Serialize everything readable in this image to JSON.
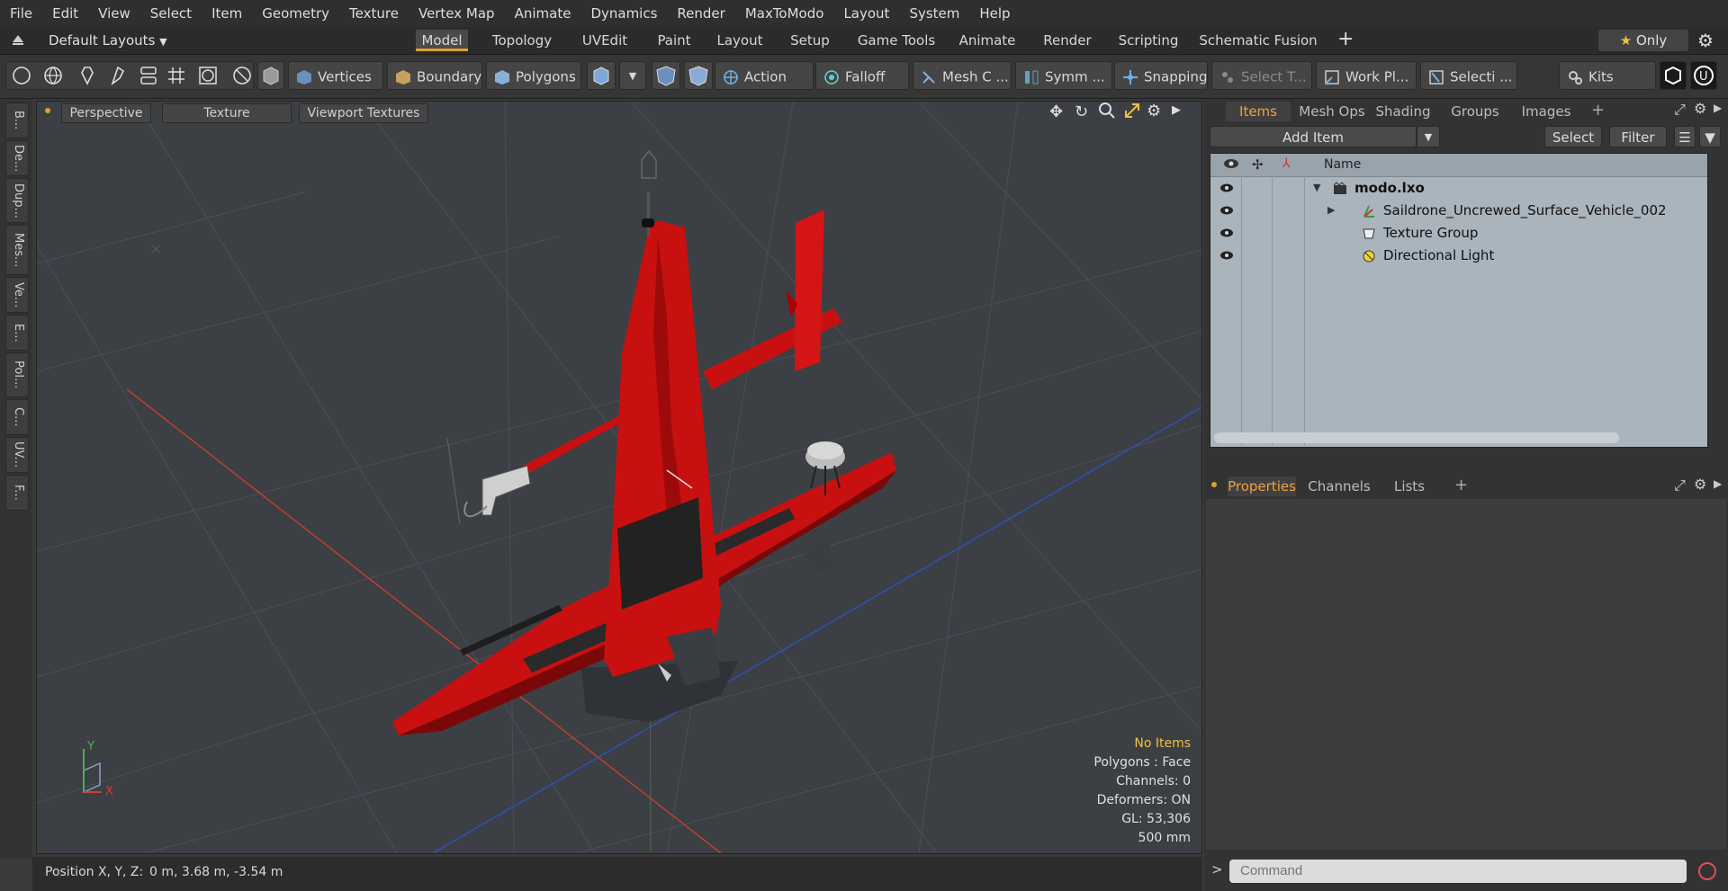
{
  "menu": [
    "File",
    "Edit",
    "View",
    "Select",
    "Item",
    "Geometry",
    "Texture",
    "Vertex Map",
    "Animate",
    "Dynamics",
    "Render",
    "MaxToModo",
    "Layout",
    "System",
    "Help"
  ],
  "layout_selector": "Default Layouts",
  "layout_tabs": [
    {
      "label": "Model",
      "active": true
    },
    {
      "label": "Topology"
    },
    {
      "label": "UVEdit"
    },
    {
      "label": "Paint"
    },
    {
      "label": "Layout"
    },
    {
      "label": "Setup"
    },
    {
      "label": "Game Tools"
    },
    {
      "label": "Animate"
    },
    {
      "label": "Render"
    },
    {
      "label": "Scripting"
    },
    {
      "label": "Schematic Fusion"
    }
  ],
  "only_label": "Only",
  "toolbar": {
    "vertices": "Vertices",
    "boundary": "Boundary",
    "polygons": "Polygons",
    "action": "Action",
    "falloff": "Falloff",
    "mesh": "Mesh C ...",
    "symm": "Symm ...",
    "snapping": "Snapping",
    "select_t": "Select T...",
    "work_plane": "Work Pl...",
    "selection": "Selecti ...",
    "kits": "Kits"
  },
  "left_tabs": [
    "B...",
    "De...",
    "Dup...",
    "Mes...",
    "Ve...",
    "E...",
    "Pol...",
    "C...",
    "UV...",
    "F..."
  ],
  "viewport": {
    "buttons": [
      "Perspective",
      "Texture",
      "Viewport Textures"
    ],
    "info": {
      "no_items": "No Items",
      "polygons": "Polygons : Face",
      "channels": "Channels: 0",
      "deformers": "Deformers: ON",
      "gl": "GL: 53,306",
      "scale": "500 mm"
    },
    "axis_y": "Y",
    "axis_x": "X"
  },
  "status": {
    "position_label": "Position X, Y, Z:",
    "position_value": "0 m, 3.68 m, -3.54 m"
  },
  "right_panel": {
    "tabs": [
      "Items",
      "Mesh Ops",
      "Shading",
      "Groups",
      "Images"
    ],
    "add_item": "Add Item",
    "select": "Select",
    "filter": "Filter",
    "column_name": "Name",
    "items": [
      {
        "name": "modo.lxo",
        "bold": true,
        "icon": "scene-icon"
      },
      {
        "name": "Saildrone_Uncrewed_Surface_Vehicle_002",
        "icon": "mesh-locator-icon"
      },
      {
        "name": "Texture Group",
        "icon": "texture-group-icon"
      },
      {
        "name": "Directional Light",
        "icon": "light-icon"
      }
    ],
    "bottom_tabs": [
      "Properties",
      "Channels",
      "Lists"
    ],
    "command_placeholder": "Command"
  },
  "colors": {
    "accent": "#e0a030",
    "boat_red": "#c81010",
    "grid_red": "#b84030",
    "grid_blue": "#3050b0"
  }
}
